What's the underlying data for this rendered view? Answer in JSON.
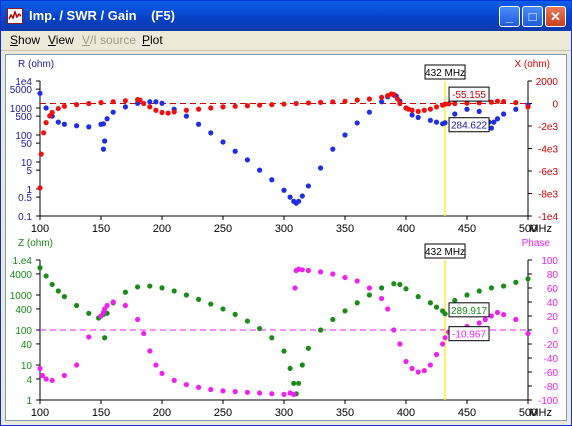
{
  "window": {
    "title": "Imp. / SWR / Gain    (F5)",
    "minimize_glyph": "_",
    "maximize_glyph": "□",
    "close_glyph": "✕"
  },
  "menu": [
    {
      "label": "Show",
      "enabled": true,
      "key": "S"
    },
    {
      "label": "View",
      "enabled": true,
      "key": "V"
    },
    {
      "label": "V/I source",
      "enabled": false,
      "key": "V"
    },
    {
      "label": "Plot",
      "enabled": true,
      "key": "P"
    }
  ],
  "colors": {
    "blue": "#1f2ee0",
    "red": "#ee1111",
    "green": "#1a8a1a",
    "magenta": "#ee22ee",
    "cursor": "#ffee33",
    "axis_blue": "#1a1aa0",
    "axis_red": "#cc0000"
  },
  "chart_data": [
    {
      "type": "scatter",
      "left_axis_label": "R (ohm)",
      "right_axis_label": "X (ohm)",
      "x_unit": "MHz",
      "x_ticks": [
        "100",
        "150",
        "200",
        "250",
        "300",
        "350",
        "400",
        "450",
        "500"
      ],
      "xlim": [
        100,
        500
      ],
      "left_ticks": [
        "1e4",
        "5000",
        "1000",
        "500",
        "100",
        "50",
        "10",
        "5",
        "1",
        "0.5",
        "0.1"
      ],
      "left_scale": "log",
      "ylim_left": [
        0.1,
        10000
      ],
      "right_ticks": [
        "2000",
        "0",
        "-2e3",
        "-4e3",
        "-6e3",
        "-8e3",
        "-1e4"
      ],
      "ylim_right": [
        -10000,
        2000
      ],
      "cursor_label": "432 MHz",
      "cursor_x": 432,
      "reference_line_right": 0,
      "readouts": [
        "-55.155",
        "284.622"
      ],
      "series": [
        {
          "name": "R (ohm)",
          "color": "blue",
          "axis": "left",
          "x": [
            100,
            105,
            110,
            115,
            120,
            130,
            140,
            150,
            152,
            152,
            153,
            155,
            160,
            170,
            180,
            190,
            195,
            200,
            210,
            220,
            230,
            240,
            250,
            260,
            270,
            280,
            290,
            300,
            305,
            308,
            310,
            312,
            315,
            320,
            330,
            340,
            350,
            360,
            370,
            380,
            385,
            390,
            392,
            395,
            400,
            405,
            410,
            420,
            425,
            430,
            432,
            440,
            450,
            460,
            468,
            470,
            472,
            475,
            480,
            490,
            500
          ],
          "y": [
            3500,
            1000,
            500,
            300,
            250,
            220,
            200,
            250,
            260,
            30,
            60,
            400,
            700,
            1100,
            1500,
            1700,
            1700,
            1500,
            900,
            500,
            250,
            120,
            55,
            25,
            12,
            5,
            2.2,
            0.9,
            0.5,
            0.35,
            0.3,
            0.35,
            0.55,
            1.3,
            6,
            30,
            100,
            280,
            700,
            1700,
            2600,
            3000,
            2800,
            1800,
            1000,
            550,
            450,
            350,
            300,
            260,
            284,
            600,
            900,
            750,
            300,
            180,
            300,
            400,
            600,
            900,
            1300
          ]
        },
        {
          "name": "X (ohm)",
          "color": "red",
          "axis": "right",
          "x": [
            100,
            101,
            103,
            105,
            108,
            110,
            115,
            120,
            130,
            140,
            150,
            160,
            170,
            180,
            182,
            185,
            190,
            195,
            200,
            205,
            210,
            220,
            230,
            240,
            250,
            260,
            270,
            280,
            290,
            300,
            310,
            320,
            330,
            340,
            350,
            360,
            370,
            380,
            385,
            388,
            390,
            393,
            395,
            400,
            402,
            405,
            410,
            415,
            420,
            425,
            430,
            432,
            435,
            440,
            450,
            460,
            470,
            475,
            480,
            490,
            500
          ],
          "y": [
            -7500,
            -4500,
            -2600,
            -1700,
            -1100,
            -800,
            -450,
            -250,
            -100,
            0,
            80,
            160,
            250,
            350,
            300,
            0,
            -300,
            -600,
            -800,
            -850,
            -750,
            -600,
            -500,
            -400,
            -300,
            -250,
            -200,
            -150,
            -100,
            -50,
            0,
            50,
            100,
            150,
            200,
            300,
            400,
            550,
            700,
            850,
            800,
            400,
            0,
            -400,
            -500,
            -600,
            -700,
            -600,
            -500,
            -300,
            -150,
            -55,
            -30,
            0,
            30,
            60,
            120,
            200,
            180,
            80,
            -300
          ]
        }
      ]
    },
    {
      "type": "scatter",
      "left_axis_label": "Z (ohm)",
      "right_axis_label": "Phase",
      "x_unit": "MHz",
      "x_ticks": [
        "100",
        "150",
        "200",
        "250",
        "300",
        "350",
        "400",
        "450",
        "500"
      ],
      "xlim": [
        100,
        500
      ],
      "left_ticks": [
        "1.e4",
        "4000",
        "1000",
        "400",
        "100",
        "40",
        "10",
        "4",
        "1"
      ],
      "left_scale": "log",
      "ylim_left": [
        1,
        10000
      ],
      "right_ticks": [
        "100",
        "80",
        "60",
        "40",
        "20",
        "0",
        "-20",
        "-40",
        "-60",
        "-80",
        "-100"
      ],
      "ylim_right": [
        -100,
        100
      ],
      "cursor_label": "432 MHz",
      "cursor_x": 432,
      "reference_line_right": 0,
      "readouts": [
        "289.917",
        "-10.967"
      ],
      "series": [
        {
          "name": "Z (ohm)",
          "color": "green",
          "axis": "left",
          "x": [
            100,
            105,
            110,
            115,
            120,
            130,
            140,
            148,
            150,
            152,
            153,
            155,
            160,
            170,
            180,
            190,
            200,
            210,
            220,
            230,
            240,
            250,
            260,
            270,
            280,
            290,
            300,
            305,
            308,
            310,
            312,
            315,
            320,
            330,
            340,
            350,
            360,
            370,
            380,
            390,
            395,
            400,
            410,
            420,
            425,
            430,
            432,
            440,
            450,
            460,
            470,
            480,
            490,
            500
          ],
          "y": [
            6000,
            3500,
            2000,
            1300,
            900,
            500,
            300,
            220,
            250,
            280,
            60,
            300,
            600,
            1200,
            1700,
            1800,
            1600,
            1300,
            1000,
            750,
            550,
            400,
            280,
            180,
            110,
            60,
            25,
            8,
            3,
            1.5,
            3,
            10,
            30,
            100,
            200,
            350,
            600,
            1000,
            1600,
            2100,
            2000,
            1500,
            900,
            600,
            450,
            350,
            290,
            700,
            1000,
            1300,
            1600,
            1800,
            2300,
            2900
          ]
        },
        {
          "name": "Phase",
          "color": "magenta",
          "axis": "right",
          "x": [
            100,
            102,
            105,
            110,
            120,
            130,
            140,
            150,
            152,
            153,
            155,
            160,
            170,
            180,
            185,
            190,
            195,
            200,
            210,
            220,
            230,
            240,
            250,
            260,
            270,
            280,
            290,
            300,
            305,
            308,
            309,
            310,
            312,
            315,
            320,
            330,
            340,
            350,
            360,
            370,
            380,
            385,
            390,
            395,
            400,
            405,
            410,
            415,
            420,
            425,
            430,
            432,
            435,
            440,
            450,
            460,
            465,
            470,
            475,
            480,
            490,
            500
          ],
          "y": [
            -55,
            -65,
            -70,
            -72,
            -65,
            -50,
            -10,
            20,
            25,
            30,
            35,
            40,
            35,
            15,
            -5,
            -30,
            -50,
            -62,
            -72,
            -78,
            -82,
            -85,
            -87,
            -88,
            -89,
            -90,
            -91,
            -92,
            -90,
            -92,
            60,
            85,
            87,
            86,
            85,
            83,
            80,
            75,
            70,
            60,
            45,
            30,
            0,
            -20,
            -45,
            -55,
            -60,
            -58,
            -50,
            -35,
            -20,
            -11,
            -3,
            0,
            5,
            10,
            15,
            20,
            25,
            22,
            15,
            -5
          ]
        }
      ]
    }
  ]
}
